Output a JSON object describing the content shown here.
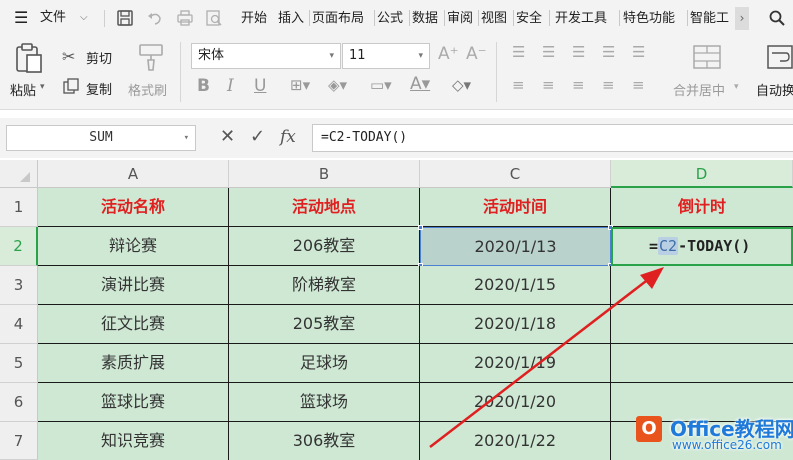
{
  "menubar": {
    "file_label": "文件",
    "tabs": [
      {
        "label": "开始",
        "active": true
      },
      {
        "label": "插入",
        "active": false
      },
      {
        "label": "页面布局",
        "active": false
      },
      {
        "label": "公式",
        "active": false
      },
      {
        "label": "数据",
        "active": false
      },
      {
        "label": "审阅",
        "active": false
      },
      {
        "label": "视图",
        "active": false
      },
      {
        "label": "安全",
        "active": false
      },
      {
        "label": "开发工具",
        "active": false
      },
      {
        "label": "特色功能",
        "active": false
      },
      {
        "label": "智能工",
        "active": false
      }
    ],
    "more_glyph": "›",
    "accent_color": "#2aa24a"
  },
  "ribbon": {
    "paste_label": "粘贴",
    "cut_label": "剪切",
    "copy_label": "复制",
    "format_painter_label": "格式刷",
    "font_name": "宋体",
    "font_size": "11",
    "merge_center_label": "合并居中",
    "auto_wrap_label": "自动换"
  },
  "formula_bar": {
    "name_box": "SUM",
    "cancel_glyph": "✕",
    "confirm_glyph": "✓",
    "fx_glyph": "fx",
    "formula": "=C2-TODAY()"
  },
  "sheet": {
    "columns": [
      "A",
      "B",
      "C",
      "D"
    ],
    "rows": [
      "1",
      "2",
      "3",
      "4",
      "5",
      "6",
      "7"
    ],
    "headers": [
      "活动名称",
      "活动地点",
      "活动时间",
      "倒计时"
    ],
    "data": [
      [
        "辩论赛",
        "206教室",
        "2020/1/13"
      ],
      [
        "演讲比赛",
        "阶梯教室",
        "2020/1/15"
      ],
      [
        "征文比赛",
        "205教室",
        "2020/1/18"
      ],
      [
        "素质扩展",
        "足球场",
        "2020/1/19"
      ],
      [
        "篮球比赛",
        "篮球场",
        "2020/1/20"
      ],
      [
        "知识竞赛",
        "306教室",
        "2020/1/22"
      ]
    ],
    "editing_cell": {
      "prefix": "=",
      "ref": "C2",
      "suffix": "-TODAY()"
    },
    "header_text_color": "#e02020",
    "cell_fill": "#cfe8d4",
    "annotation_arrow_color": "#e02020"
  },
  "watermark": {
    "title": "Office教程网",
    "url": "www.office26.com"
  }
}
